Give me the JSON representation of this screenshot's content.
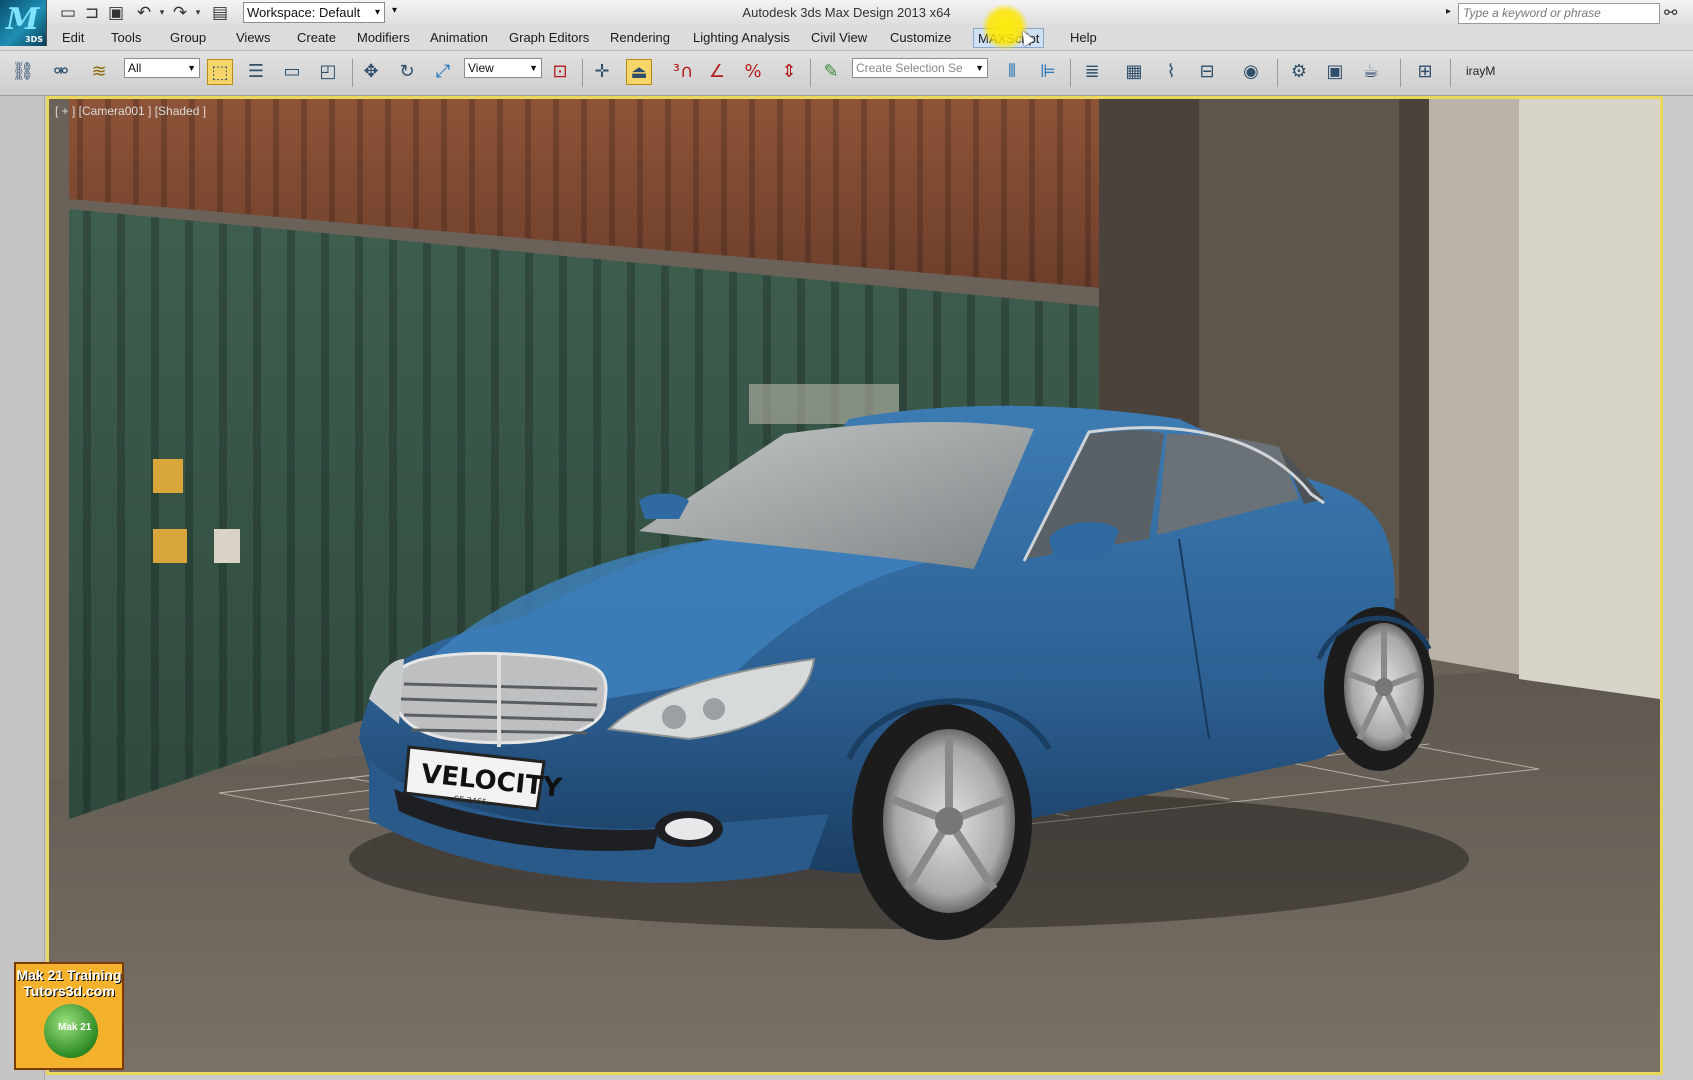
{
  "titlebar": {
    "app_title": "Autodesk 3ds Max Design 2013 x64",
    "logo_sub": "3DS",
    "workspace_value": "Workspace: Default",
    "search_placeholder": "Type a keyword or phrase"
  },
  "menubar": {
    "items": [
      "Edit",
      "Tools",
      "Group",
      "Views",
      "Create",
      "Modifiers",
      "Animation",
      "Graph Editors",
      "Rendering",
      "Lighting Analysis",
      "Civil View",
      "Customize",
      "MAXScript",
      "Help"
    ],
    "active_index": 12
  },
  "toolbar": {
    "selection_filter": "All",
    "reference_coord": "View",
    "named_selection_placeholder": "Create Selection Se",
    "renderer_label": "irayM"
  },
  "viewport": {
    "label": "[ + ] [Camera001 ] [Shaded ]",
    "plate_text": "VELOCITY",
    "plate_sub": "SE 2465"
  },
  "watermark": {
    "line1": "Mak 21 Training",
    "line2": "Tutors3d.com",
    "teapot_text": "Mak 21"
  },
  "colors": {
    "viewport_border": "#e8d95c",
    "car_paint": "#2e6496",
    "container_green": "#3b5a4a",
    "container_rust": "#8a5033",
    "highlight_yellow": "#ffe600"
  }
}
